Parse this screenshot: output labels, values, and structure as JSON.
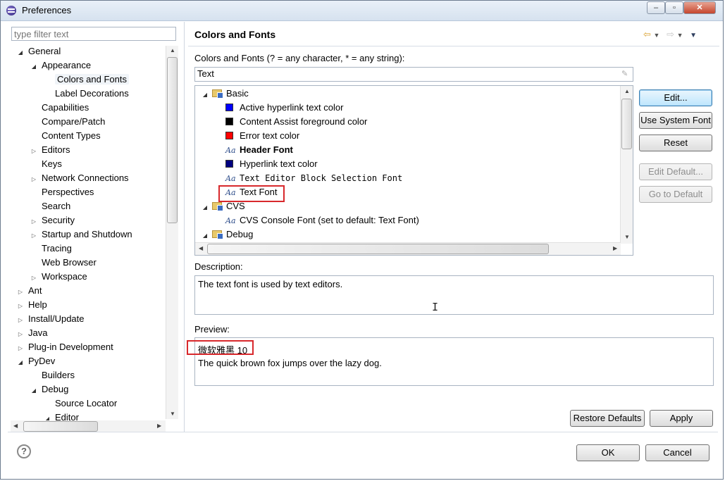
{
  "window": {
    "title": "Preferences"
  },
  "left_pane": {
    "filter_placeholder": "type filter text",
    "tree": [
      {
        "label": "General",
        "indent": 0,
        "twisty": "open"
      },
      {
        "label": "Appearance",
        "indent": 1,
        "twisty": "open"
      },
      {
        "label": "Colors and Fonts",
        "indent": 2,
        "twisty": "none",
        "selected": true
      },
      {
        "label": "Label Decorations",
        "indent": 2,
        "twisty": "none"
      },
      {
        "label": "Capabilities",
        "indent": 1,
        "twisty": "none"
      },
      {
        "label": "Compare/Patch",
        "indent": 1,
        "twisty": "none"
      },
      {
        "label": "Content Types",
        "indent": 1,
        "twisty": "none"
      },
      {
        "label": "Editors",
        "indent": 1,
        "twisty": "closed"
      },
      {
        "label": "Keys",
        "indent": 1,
        "twisty": "none"
      },
      {
        "label": "Network Connections",
        "indent": 1,
        "twisty": "closed"
      },
      {
        "label": "Perspectives",
        "indent": 1,
        "twisty": "none"
      },
      {
        "label": "Search",
        "indent": 1,
        "twisty": "none"
      },
      {
        "label": "Security",
        "indent": 1,
        "twisty": "closed"
      },
      {
        "label": "Startup and Shutdown",
        "indent": 1,
        "twisty": "closed"
      },
      {
        "label": "Tracing",
        "indent": 1,
        "twisty": "none"
      },
      {
        "label": "Web Browser",
        "indent": 1,
        "twisty": "none"
      },
      {
        "label": "Workspace",
        "indent": 1,
        "twisty": "closed"
      },
      {
        "label": "Ant",
        "indent": 0,
        "twisty": "closed"
      },
      {
        "label": "Help",
        "indent": 0,
        "twisty": "closed"
      },
      {
        "label": "Install/Update",
        "indent": 0,
        "twisty": "closed"
      },
      {
        "label": "Java",
        "indent": 0,
        "twisty": "closed"
      },
      {
        "label": "Plug-in Development",
        "indent": 0,
        "twisty": "closed"
      },
      {
        "label": "PyDev",
        "indent": 0,
        "twisty": "open"
      },
      {
        "label": "Builders",
        "indent": 1,
        "twisty": "none"
      },
      {
        "label": "Debug",
        "indent": 1,
        "twisty": "open"
      },
      {
        "label": "Source Locator",
        "indent": 2,
        "twisty": "none"
      },
      {
        "label": "Editor",
        "indent": 2,
        "twisty": "open"
      }
    ]
  },
  "page": {
    "title": "Colors and Fonts",
    "filter_label": "Colors and Fonts (? = any character, * = any string):",
    "filter_value": "Text",
    "items": [
      {
        "label": "Basic",
        "indent": 0,
        "kind": "folder"
      },
      {
        "label": "Active hyperlink text color",
        "indent": 1,
        "kind": "color",
        "color": "#0000ff"
      },
      {
        "label": "Content Assist foreground color",
        "indent": 1,
        "kind": "color",
        "color": "#000000"
      },
      {
        "label": "Error text color",
        "indent": 1,
        "kind": "color",
        "color": "#ff0000"
      },
      {
        "label": "Header Font",
        "indent": 1,
        "kind": "font",
        "style": "bold"
      },
      {
        "label": "Hyperlink text color",
        "indent": 1,
        "kind": "color",
        "color": "#000080"
      },
      {
        "label": "Text Editor Block Selection Font",
        "indent": 1,
        "kind": "font",
        "style": "mono"
      },
      {
        "label": "Text Font",
        "indent": 1,
        "kind": "font",
        "style": "normal",
        "highlighted": true
      },
      {
        "label": "CVS",
        "indent": 0,
        "kind": "folder"
      },
      {
        "label": "CVS Console Font (set to default: Text Font)",
        "indent": 1,
        "kind": "font",
        "style": "normal"
      },
      {
        "label": "Debug",
        "indent": 0,
        "kind": "folder"
      }
    ],
    "font_icon_text": "Aa",
    "buttons": {
      "edit": "Edit...",
      "use_system_font": "Use System Font",
      "reset": "Reset",
      "edit_default": "Edit Default...",
      "go_to_default": "Go to Default"
    },
    "description_label": "Description:",
    "description_text": "The text font is used by text editors.",
    "preview_label": "Preview:",
    "preview_font_name": "微软雅黑 10",
    "preview_sample": "The quick brown fox jumps over the lazy dog.",
    "restore_defaults": "Restore Defaults",
    "apply": "Apply"
  },
  "footer": {
    "ok": "OK",
    "cancel": "Cancel",
    "help_icon": "?"
  },
  "icons": {
    "window": "eclipse-icon",
    "back": "back-arrow-icon",
    "forward": "forward-arrow-icon",
    "menu": "view-menu-icon"
  }
}
